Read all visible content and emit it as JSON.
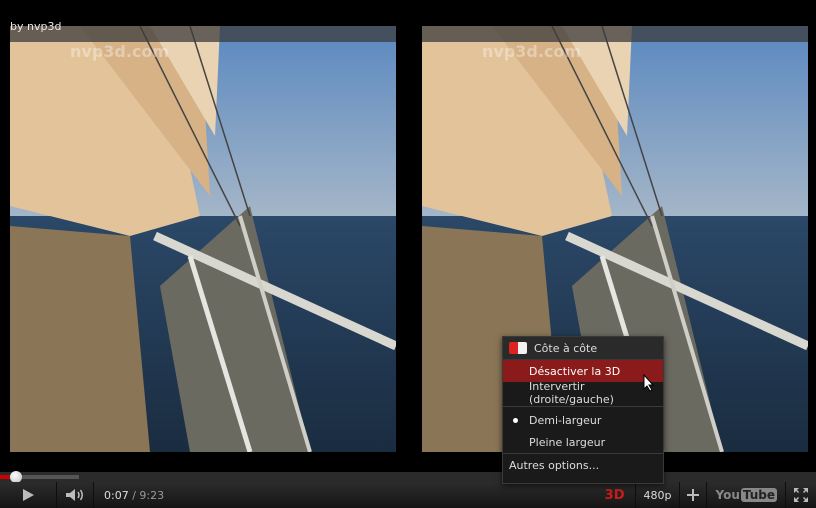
{
  "byline": "by nvp3d",
  "watermark": "nvp3d.com",
  "menu": {
    "title": "Côte à côte",
    "items": [
      {
        "label": "Désactiver la 3D",
        "active": true
      },
      {
        "label": "Intervertir (droite/gauche)",
        "active": false
      }
    ],
    "width_options": [
      {
        "label": "Demi-largeur",
        "selected": true
      },
      {
        "label": "Pleine largeur",
        "selected": false
      }
    ],
    "more": "Autres options..."
  },
  "player": {
    "current_time": "0:07",
    "duration": "/ 9:23",
    "played_fraction": 0.0124,
    "buffered_fraction": 0.097,
    "btn_3d": "3D",
    "quality": "480p",
    "youtube_logo": "YouTube"
  },
  "icons": [
    "play-icon",
    "volume-icon",
    "plus-icon",
    "fullscreen-icon",
    "stereo-mode-icon",
    "mouse-cursor-icon"
  ],
  "colors": {
    "accent": "#cc1b1b",
    "menu_active": "#8b1a1a"
  }
}
